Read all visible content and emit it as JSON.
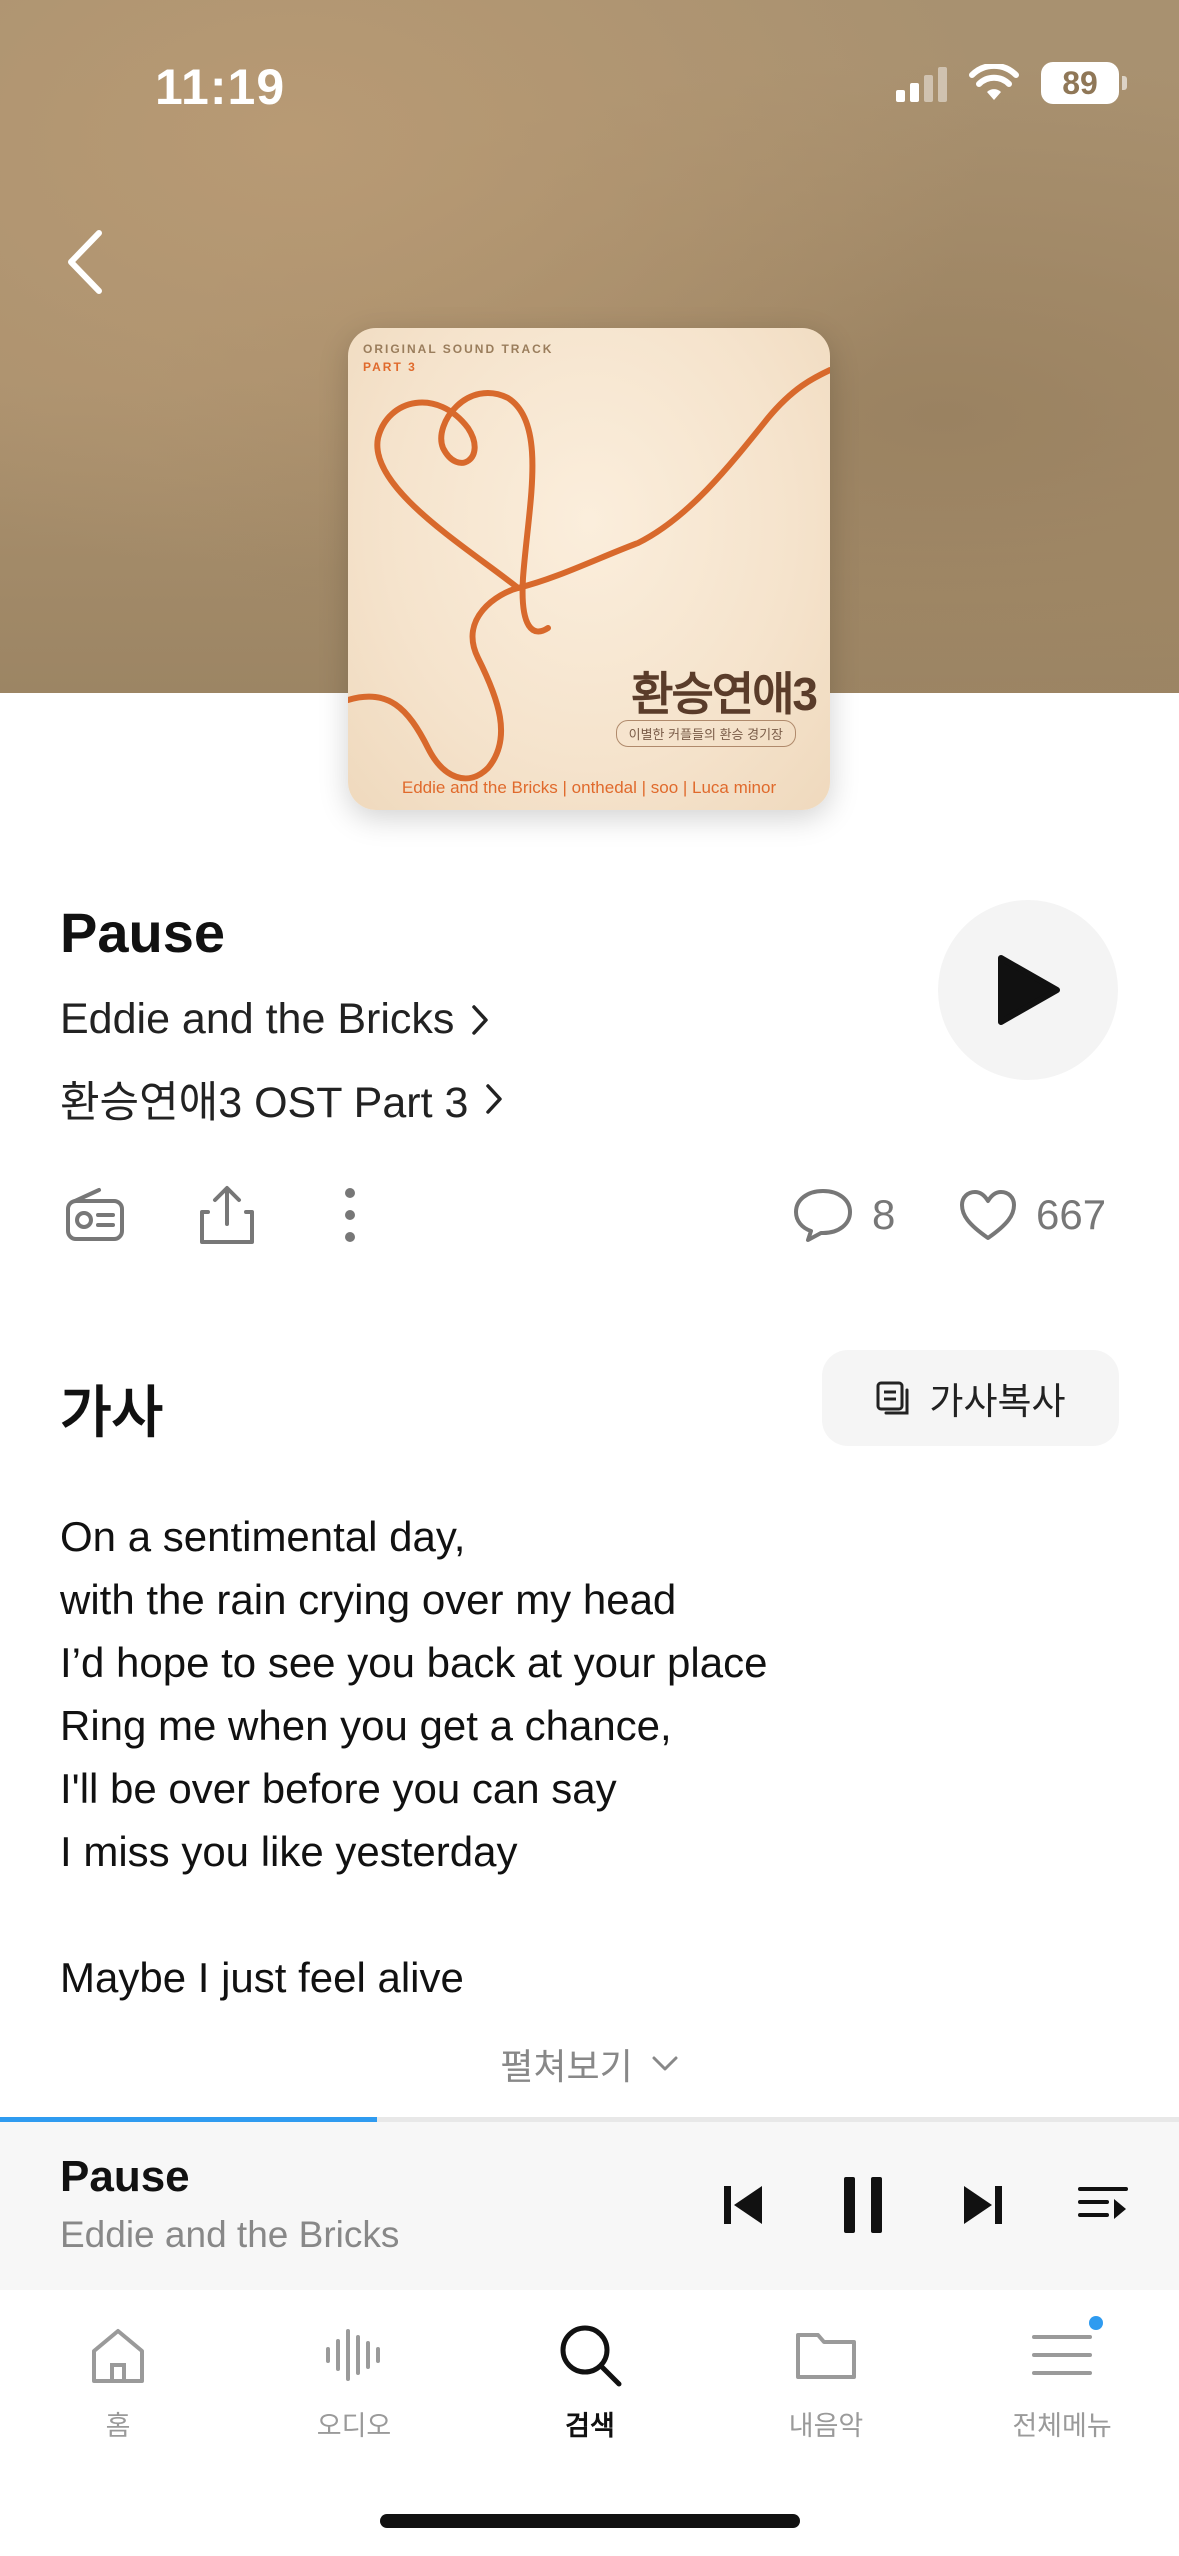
{
  "status_bar": {
    "time": "11:19",
    "battery": "89"
  },
  "album_art": {
    "top_line": "ORIGINAL SOUND TRACK",
    "part_line": "PART 3",
    "title": "환승연애3",
    "subtitle": "이별한 커플들의 환승 경기장",
    "artists": "Eddie and the Bricks | onthedal | soo | Luca minor"
  },
  "song": {
    "title": "Pause",
    "artist": "Eddie and the Bricks",
    "album": "환승연애3 OST Part 3"
  },
  "actions": {
    "comments": "8",
    "likes": "667"
  },
  "lyrics": {
    "heading": "가사",
    "copy_label": "가사복사",
    "lines_block1": [
      "On a sentimental day,",
      "with the rain crying over my head",
      "I’d hope to see you back at your place",
      "Ring me when you get a chance,",
      "I'll be over before you can say",
      "I miss you like yesterday"
    ],
    "lines_block2": [
      "Maybe I just feel alive"
    ],
    "expand_label": "펼쳐보기"
  },
  "player": {
    "title": "Pause",
    "artist": "Eddie and the Bricks",
    "progress": 0.32
  },
  "tabs": [
    {
      "label": "홈",
      "icon": "home-icon"
    },
    {
      "label": "오디오",
      "icon": "audio-wave-icon"
    },
    {
      "label": "검색",
      "icon": "search-icon"
    },
    {
      "label": "내음악",
      "icon": "folder-icon"
    },
    {
      "label": "전체메뉴",
      "icon": "menu-icon"
    }
  ],
  "colors": {
    "accent": "#2f9bf0",
    "album_orange": "#e06a2c"
  }
}
